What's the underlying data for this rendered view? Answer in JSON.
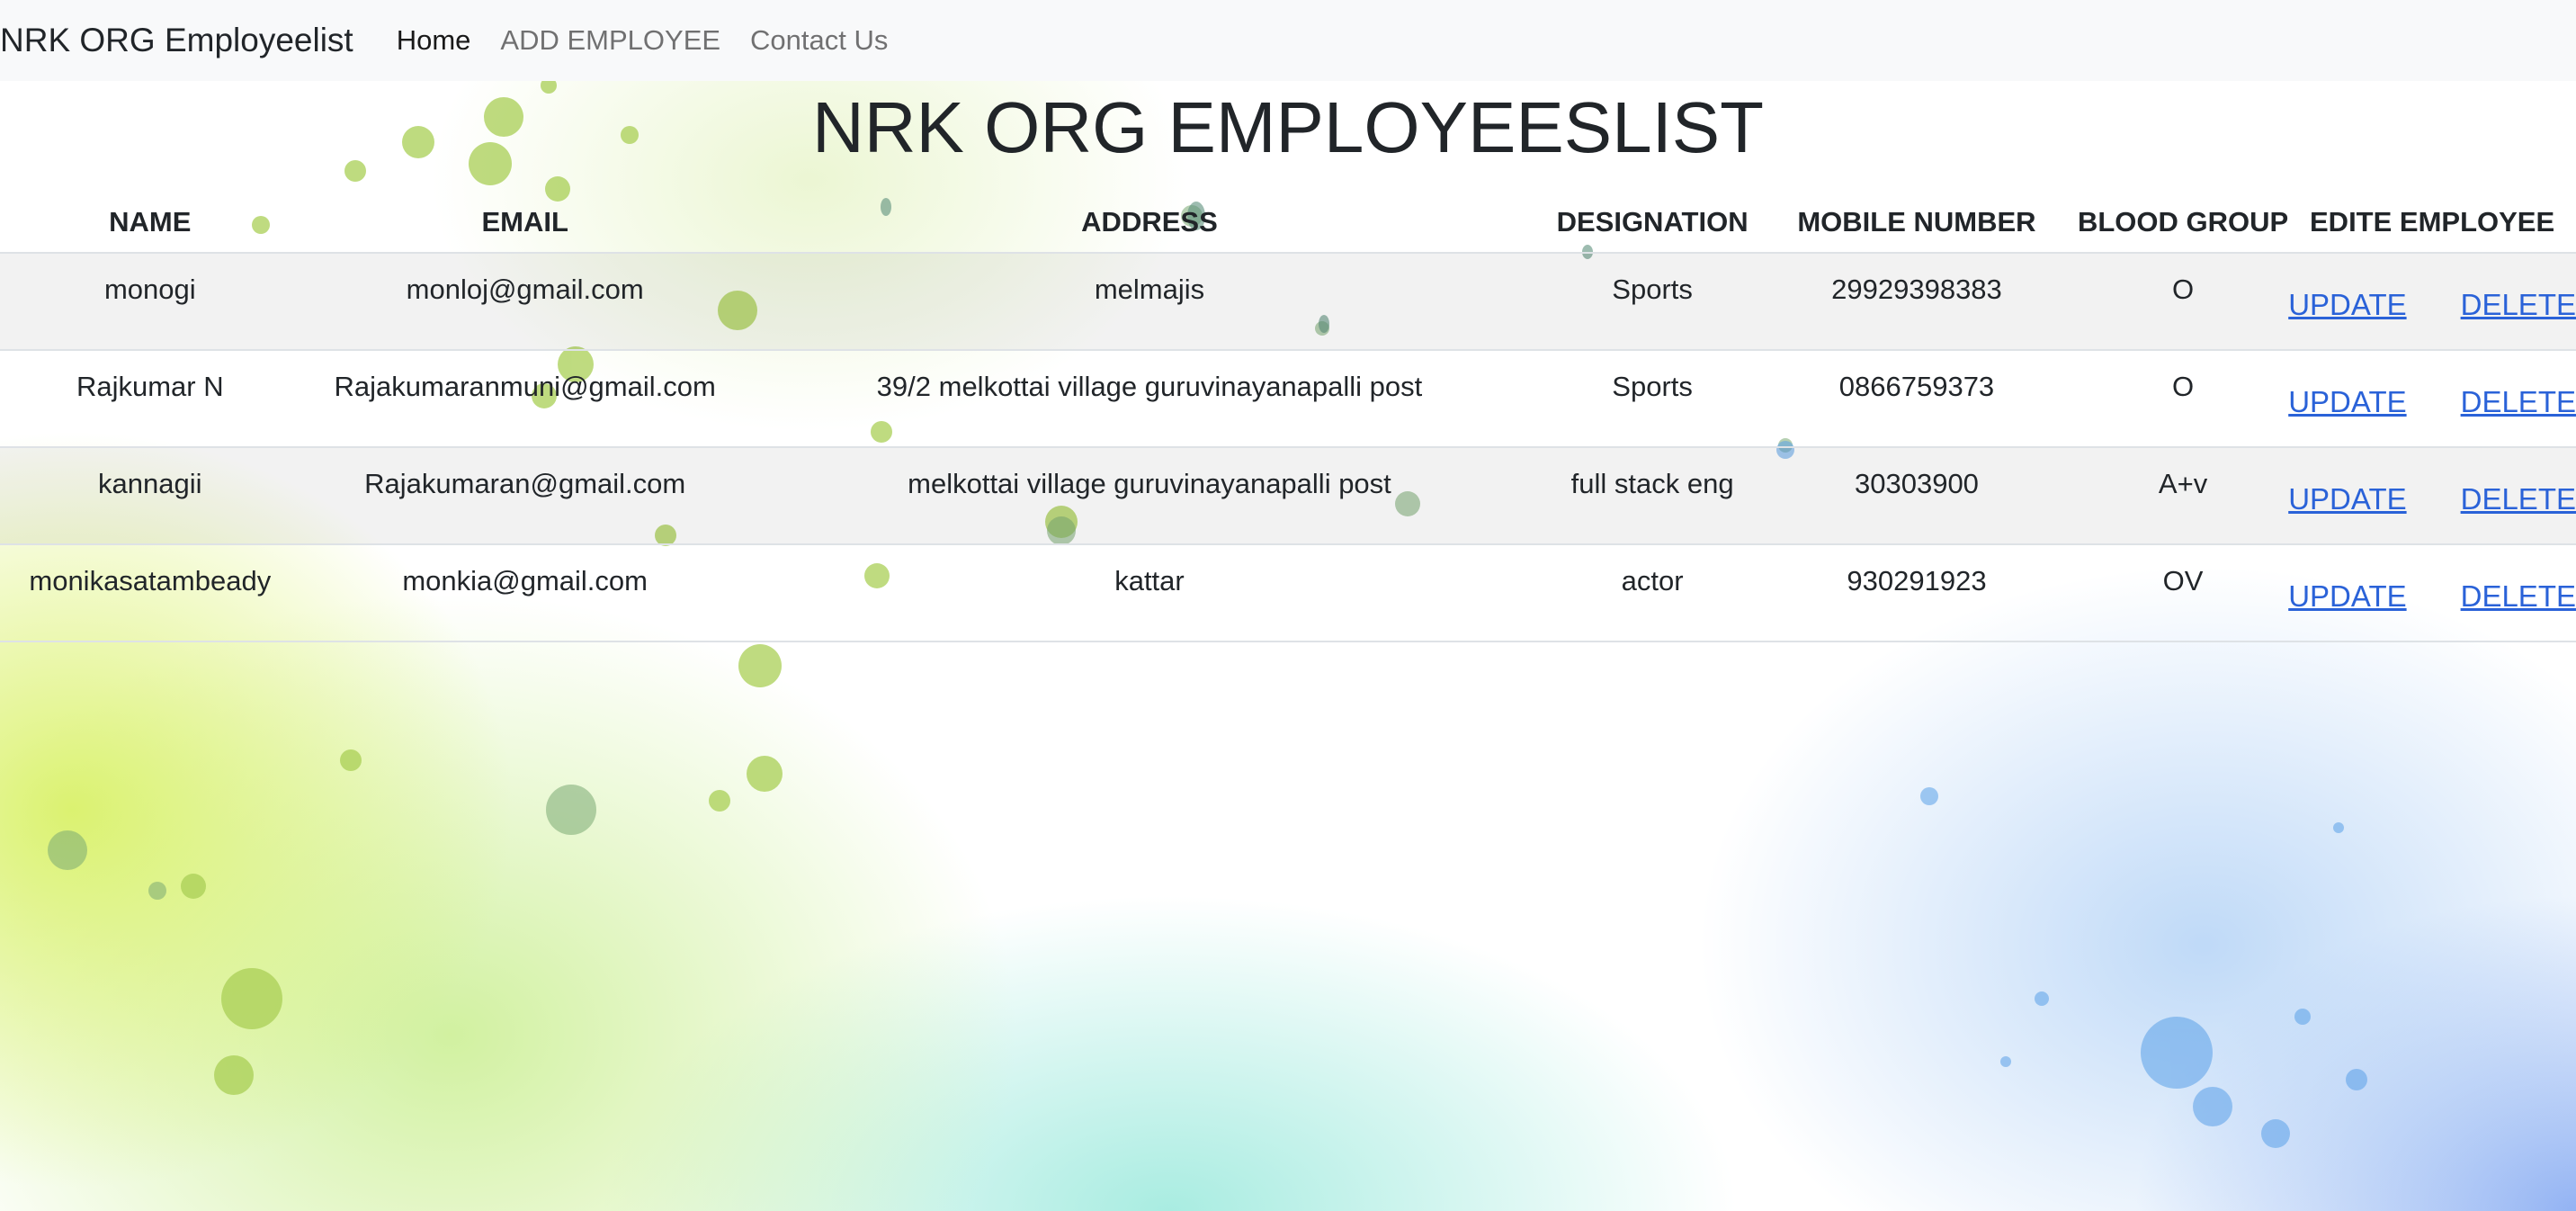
{
  "navbar": {
    "brand": "NRK ORG Employeelist",
    "links": [
      "Home",
      "ADD EMPLOYEE",
      "Contact Us"
    ]
  },
  "page": {
    "title": "NRK ORG EMPLOYEESLIST"
  },
  "table": {
    "headers": [
      "NAME",
      "EMAIL",
      "ADDRESS",
      "DESIGNATION",
      "MOBILE NUMBER",
      "BLOOD GROUP",
      "EDITE EMPLOYEE"
    ],
    "rows": [
      {
        "name": "monogi",
        "email": "monloj@gmail.com",
        "address": "melmajis",
        "designation": "Sports",
        "mobile": "29929398383",
        "blood_group": "O"
      },
      {
        "name": "Rajkumar N",
        "email": "Rajakumaranmuni@gmail.com",
        "address": "39/2 melkottai village guruvinayanapalli post",
        "designation": "Sports",
        "mobile": "0866759373",
        "blood_group": "O"
      },
      {
        "name": "kannagii",
        "email": "Rajakumaran@gmail.com",
        "address": "melkottai village guruvinayanapalli post",
        "designation": "full stack eng",
        "mobile": "30303900",
        "blood_group": "A+v"
      },
      {
        "name": "monikasatambeady",
        "email": "monkia@gmail.com",
        "address": "kattar",
        "designation": "actor",
        "mobile": "930291923",
        "blood_group": "OV"
      }
    ],
    "update_label": "UPDATE",
    "delete_label": "DELETE"
  },
  "colors": {
    "link": "#2a62d8",
    "navbar_bg": "#f8f9fa",
    "text": "#212529"
  }
}
